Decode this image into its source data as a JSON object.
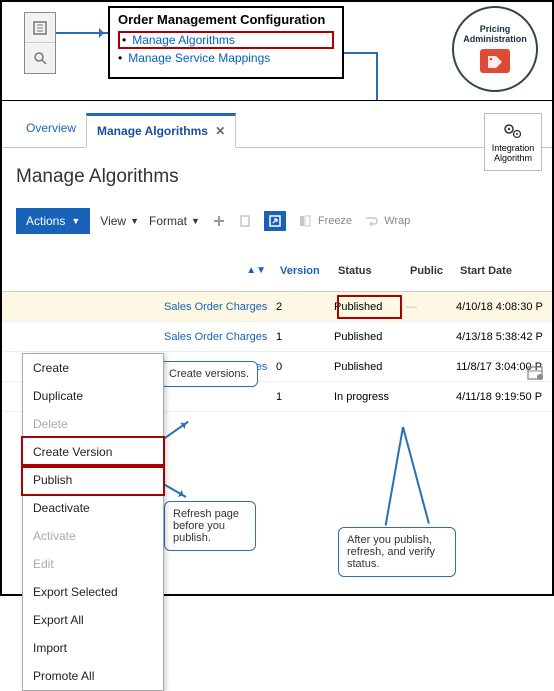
{
  "diagram": {
    "icons": {
      "list": "list-icon",
      "search": "search-icon"
    },
    "omc": {
      "title": "Order Management Configuration",
      "items": [
        {
          "label": "Manage Algorithms",
          "highlight": true
        },
        {
          "label": "Manage Service Mappings",
          "highlight": false
        }
      ]
    },
    "pricing": {
      "line1": "Pricing",
      "line2": "Administration",
      "icon": "price-tag-icon"
    }
  },
  "app": {
    "tabs": [
      {
        "label": "Overview",
        "active": false,
        "closable": false
      },
      {
        "label": "Manage Algorithms",
        "active": true,
        "closable": true
      }
    ],
    "integration_button": {
      "line1": "Integration",
      "line2": "Algorithm"
    },
    "page_title": "Manage Algorithms",
    "toolbar": {
      "actions_label": "Actions",
      "view_label": "View",
      "format_label": "Format",
      "freeze_label": "Freeze",
      "wrap_label": "Wrap"
    },
    "actions_menu": [
      {
        "label": "Create",
        "disabled": false,
        "highlight": null
      },
      {
        "label": "Duplicate",
        "disabled": false,
        "highlight": null
      },
      {
        "label": "Delete",
        "disabled": true,
        "highlight": null
      },
      {
        "label": "Create Version",
        "disabled": false,
        "highlight": "red"
      },
      {
        "label": "Publish",
        "disabled": false,
        "highlight": "red"
      },
      {
        "label": "Deactivate",
        "disabled": false,
        "highlight": null
      },
      {
        "label": "Activate",
        "disabled": true,
        "highlight": null
      },
      {
        "label": "Edit",
        "disabled": true,
        "highlight": null
      },
      {
        "label": "Export Selected",
        "disabled": false,
        "highlight": null
      },
      {
        "label": "Export All",
        "disabled": false,
        "highlight": null
      },
      {
        "label": "Import",
        "disabled": false,
        "highlight": null
      },
      {
        "label": "Promote All",
        "disabled": false,
        "highlight": null
      }
    ],
    "table": {
      "columns": {
        "name": "",
        "version": "Version",
        "status": "Status",
        "public": "Public",
        "start_date": "Start Date"
      },
      "sort_indicator": "▲▼",
      "rows": [
        {
          "name": "Sales Order Charges",
          "version": "2",
          "status": "Published",
          "public": "—",
          "start_date": "4/10/18 4:08:30 P",
          "highlight": true,
          "link": true
        },
        {
          "name": "Sales Order Charges",
          "version": "1",
          "status": "Published",
          "public": "",
          "start_date": "4/13/18 5:38:42 P",
          "highlight": false,
          "link": true
        },
        {
          "name": "Sales Order Charges",
          "version": "0",
          "status": "Published",
          "public": "",
          "start_date": "11/8/17 3:04:00 P",
          "highlight": false,
          "link": true
        },
        {
          "name": "",
          "version": "1",
          "status": "In progress",
          "public": "",
          "start_date": "4/11/18 9:19:50 P",
          "highlight": false,
          "link": false
        }
      ]
    },
    "callouts": {
      "c1": "Create versions.",
      "c2_line1": "Refresh page",
      "c2_line2": "before you",
      "c2_line3": "publish.",
      "c3_line1": "After you publish,",
      "c3_line2": "refresh, and verify",
      "c3_line3": "status."
    }
  }
}
